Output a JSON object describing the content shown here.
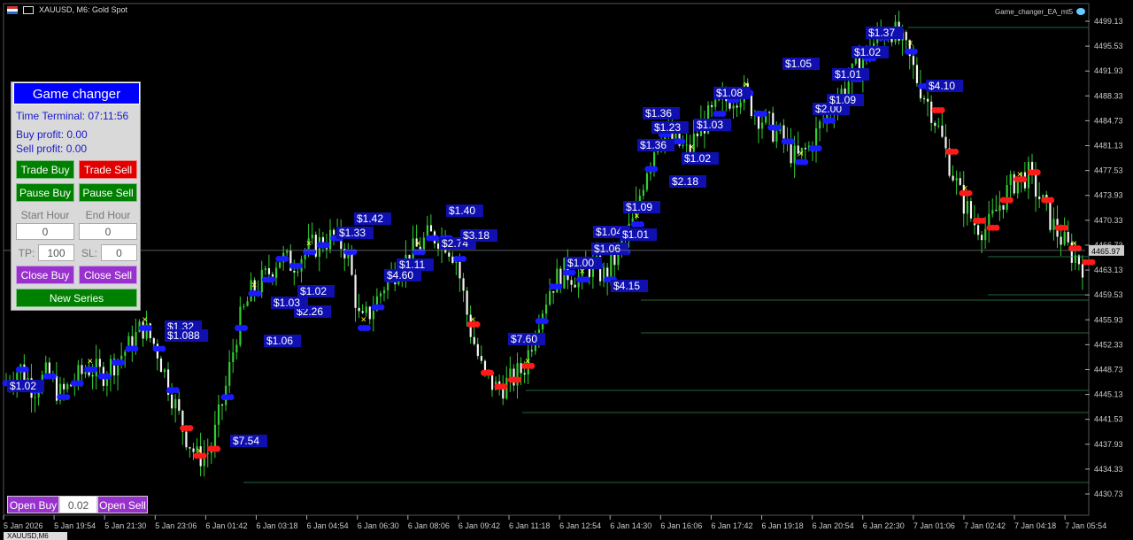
{
  "window": {
    "title": "XAUUSD, M6:  Gold Spot",
    "ea_name": "Game_changer_EA_mt5"
  },
  "panel": {
    "title": "Game changer",
    "time_label": "Time Terminal: 07:11:56",
    "buy_profit": "Buy profit: 0.00",
    "sell_profit": "Sell profit: 0.00",
    "trade_buy": "Trade Buy",
    "trade_sell": "Trade Sell",
    "pause_buy": "Pause Buy",
    "pause_sell": "Pause Sell",
    "start_hour_label": "Start Hour",
    "end_hour_label": "End Hour",
    "start_hour": "0",
    "end_hour": "0",
    "tp_label": "TP:",
    "tp_value": "100",
    "sl_label": "SL:",
    "sl_value": "0",
    "close_buy": "Close Buy",
    "close_sell": "Close Sell",
    "new_series": "New Series"
  },
  "bottom": {
    "open_buy": "Open Buy",
    "lot": "0.02",
    "open_sell": "Open Sell",
    "tab": "XAUUSD,M6"
  },
  "axis": {
    "price_labels": [
      "4499.13",
      "4495.53",
      "4491.93",
      "4488.33",
      "4484.73",
      "4481.13",
      "4477.53",
      "4473.93",
      "4470.33",
      "4466.73",
      "4463.13",
      "4459.53",
      "4455.93",
      "4452.33",
      "4448.73",
      "4445.13",
      "4441.53",
      "4437.93",
      "4434.33",
      "4430.73"
    ],
    "current_price": "4465.97",
    "dates": [
      "5 Jan 2026",
      "5 Jan 19:54",
      "5 Jan 21:30",
      "5 Jan 23:06",
      "6 Jan 01:42",
      "6 Jan 03:18",
      "6 Jan 04:54",
      "6 Jan 06:30",
      "6 Jan 08:06",
      "6 Jan 09:42",
      "6 Jan 11:18",
      "6 Jan 12:54",
      "6 Jan 14:30",
      "6 Jan 16:06",
      "6 Jan 17:42",
      "6 Jan 19:18",
      "6 Jan 20:54",
      "6 Jan 22:30",
      "7 Jan 01:06",
      "7 Jan 02:42",
      "7 Jan 04:18",
      "7 Jan 05:54"
    ]
  },
  "chart_data": {
    "type": "candlestick",
    "symbol": "XAUUSD",
    "timeframe": "M6",
    "ylim": [
      4428.9,
      4500.9
    ],
    "close_path": [
      [
        0,
        4447
      ],
      [
        1,
        4449
      ],
      [
        2,
        4446
      ],
      [
        3,
        4448
      ],
      [
        4,
        4445
      ],
      [
        5,
        4447
      ],
      [
        6,
        4449
      ],
      [
        7,
        4448
      ],
      [
        8,
        4450
      ],
      [
        9,
        4452
      ],
      [
        10,
        4455
      ],
      [
        11,
        4452
      ],
      [
        12,
        4446
      ],
      [
        13,
        4440
      ],
      [
        14,
        4436
      ],
      [
        15,
        4437
      ],
      [
        16,
        4445
      ],
      [
        17,
        4455
      ],
      [
        18,
        4460
      ],
      [
        19,
        4462
      ],
      [
        20,
        4465
      ],
      [
        21,
        4464
      ],
      [
        22,
        4466
      ],
      [
        23,
        4467
      ],
      [
        24,
        4468
      ],
      [
        25,
        4466
      ],
      [
        26,
        4455
      ],
      [
        27,
        4458
      ],
      [
        28,
        4462
      ],
      [
        29,
        4464
      ],
      [
        30,
        4466
      ],
      [
        31,
        4468
      ],
      [
        32,
        4468
      ],
      [
        33,
        4465
      ],
      [
        34,
        4455
      ],
      [
        35,
        4448
      ],
      [
        36,
        4446
      ],
      [
        37,
        4447
      ],
      [
        38,
        4449
      ],
      [
        39,
        4456
      ],
      [
        40,
        4461
      ],
      [
        41,
        4463
      ],
      [
        42,
        4462
      ],
      [
        43,
        4464
      ],
      [
        44,
        4462
      ],
      [
        45,
        4466
      ],
      [
        46,
        4470
      ],
      [
        47,
        4478
      ],
      [
        48,
        4483
      ],
      [
        49,
        4482
      ],
      [
        50,
        4480
      ],
      [
        51,
        4484
      ],
      [
        52,
        4486
      ],
      [
        53,
        4488
      ],
      [
        54,
        4489
      ],
      [
        55,
        4486
      ],
      [
        56,
        4484
      ],
      [
        57,
        4482
      ],
      [
        58,
        4479
      ],
      [
        59,
        4481
      ],
      [
        60,
        4485
      ],
      [
        61,
        4488
      ],
      [
        62,
        4491
      ],
      [
        63,
        4494
      ],
      [
        64,
        4497
      ],
      [
        65,
        4498
      ],
      [
        66,
        4495
      ],
      [
        67,
        4490
      ],
      [
        68,
        4486
      ],
      [
        69,
        4480
      ],
      [
        70,
        4474
      ],
      [
        71,
        4470
      ],
      [
        72,
        4469
      ],
      [
        73,
        4473
      ],
      [
        74,
        4476
      ],
      [
        75,
        4477
      ],
      [
        76,
        4473
      ],
      [
        77,
        4469
      ],
      [
        78,
        4466
      ],
      [
        79,
        4464
      ]
    ],
    "trade_labels": [
      "$1.02",
      "$1.32",
      "$1.088",
      "$7.54",
      "$1.06",
      "$1.02",
      "$2.26",
      "$1.03",
      "$1.33",
      "$1.42",
      "$4.60",
      "$1.11",
      "$1.40",
      "$2.74",
      "$3.18",
      "$7.60",
      "$1.00",
      "$1.06",
      "$1.09",
      "$1.04",
      "$1.01",
      "$1.36",
      "$4.15",
      "$1.23",
      "$1.36",
      "$1.08",
      "$2.18",
      "$1.02",
      "$1.03",
      "$1.05",
      "$1.01",
      "$2.00",
      "$1.09",
      "$1.02",
      "$1.37",
      "$4.10"
    ]
  }
}
